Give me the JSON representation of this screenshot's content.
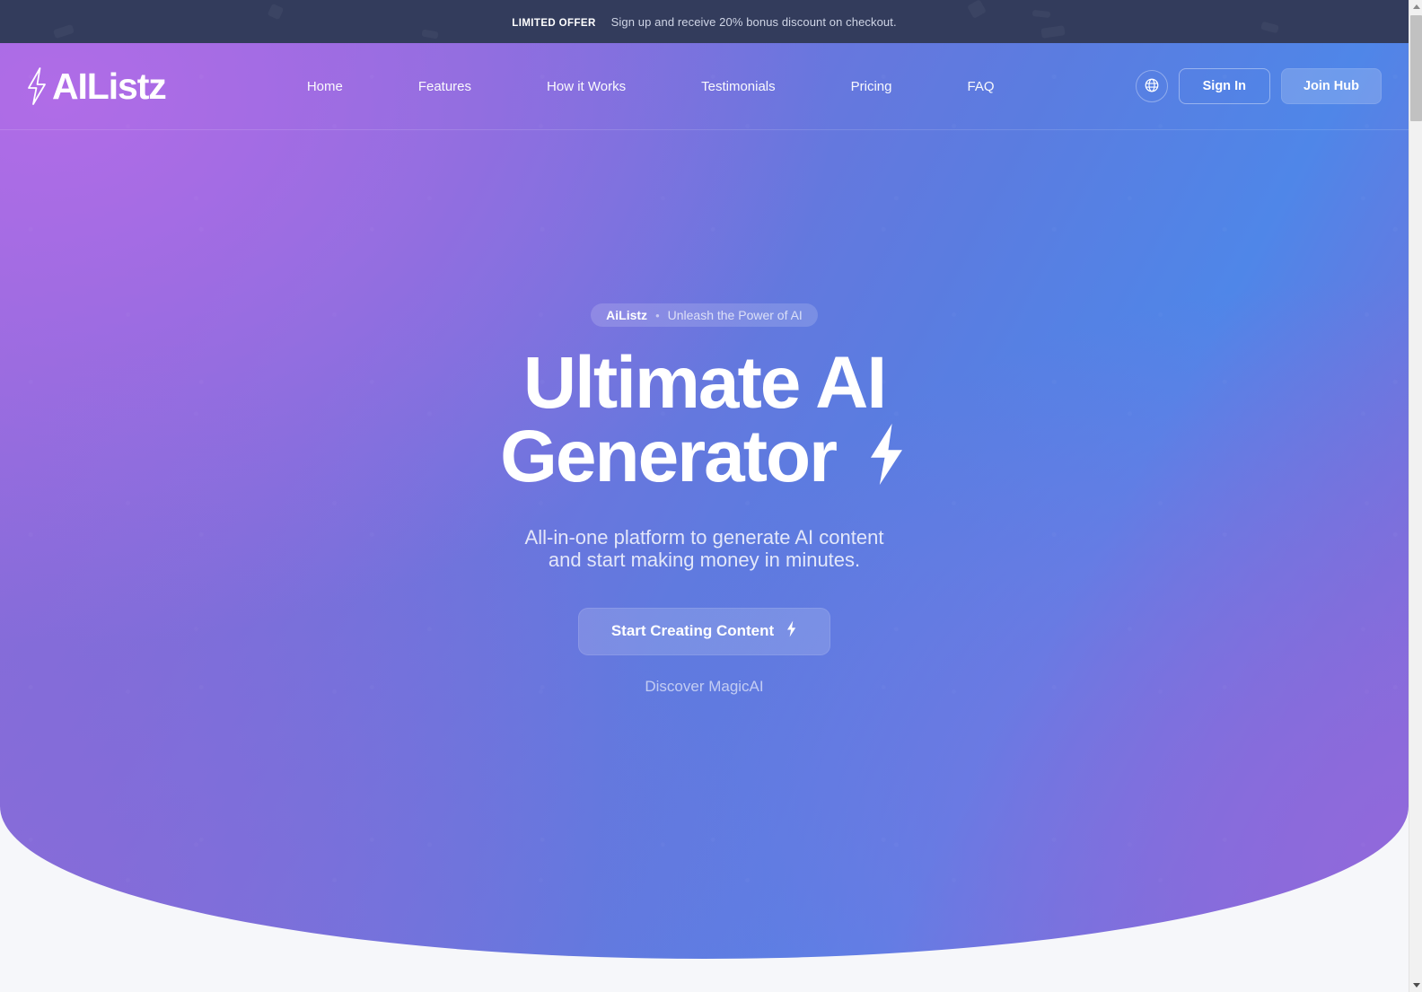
{
  "announcement": {
    "tag": "LIMITED OFFER",
    "message": "Sign up and receive 20% bonus discount on checkout."
  },
  "navbar": {
    "brand": "AIListz",
    "brand_icon": "lightning-bolt-outline-icon",
    "links": [
      {
        "label": "Home"
      },
      {
        "label": "Features"
      },
      {
        "label": "How it Works"
      },
      {
        "label": "Testimonials"
      },
      {
        "label": "Pricing"
      },
      {
        "label": "FAQ"
      }
    ],
    "language_icon": "globe-icon",
    "sign_in_label": "Sign In",
    "join_label": "Join Hub"
  },
  "hero": {
    "badge_brand": "AiListz",
    "badge_separator": "•",
    "badge_text": "Unleash the Power of AI",
    "title_line1": "Ultimate AI",
    "title_line2": "Generator",
    "title_icon": "lightning-bolt-filled-icon",
    "subtitle_line1": "All-in-one platform to generate AI content",
    "subtitle_line2": "and start making money in minutes.",
    "cta_label": "Start Creating Content",
    "cta_icon": "lightning-bolt-filled-icon",
    "secondary_link": "Discover MagicAI"
  },
  "colors": {
    "announcement_bg": "#333c5c",
    "hero_purple": "#8f6ad9",
    "hero_blue": "#4f86e8",
    "page_bg": "#f6f7fa",
    "text_on_hero": "#ffffff"
  }
}
